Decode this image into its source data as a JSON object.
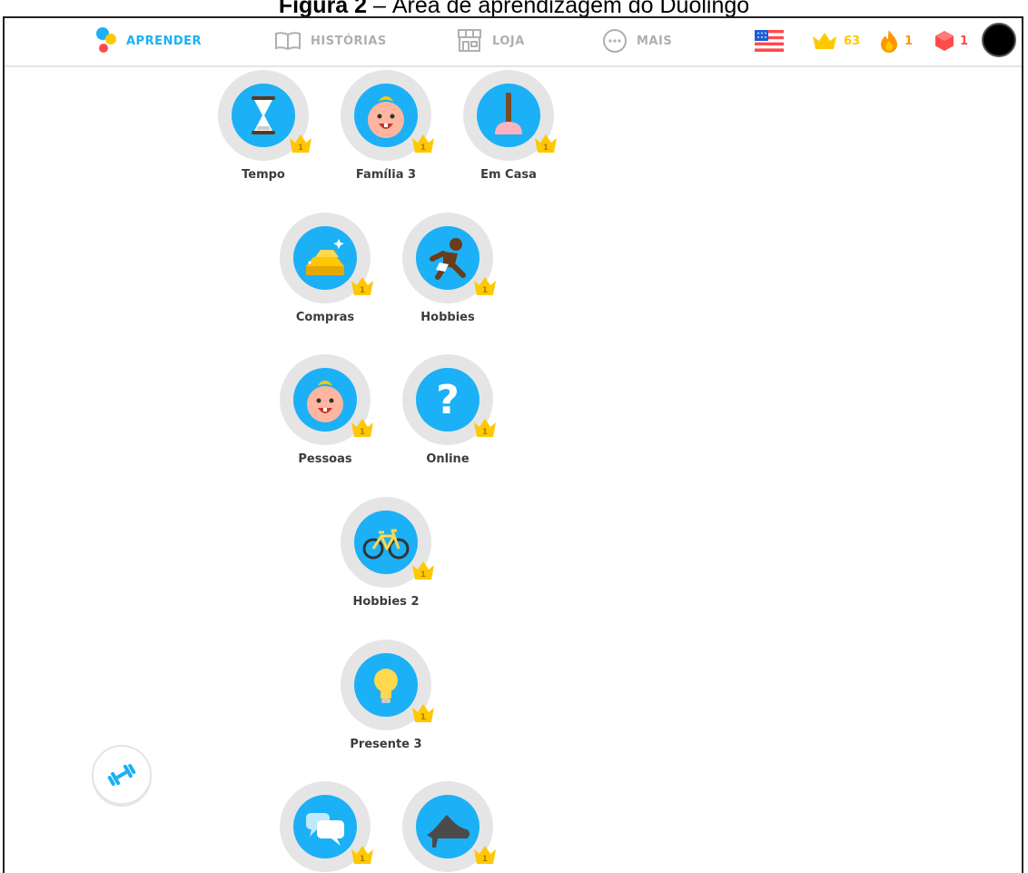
{
  "caption": {
    "prefix": "Figura 2",
    "rest": " – Área de aprendizagem do Duolingo"
  },
  "nav": {
    "learn": "APRENDER",
    "stories": "HISTÓRIAS",
    "shop": "LOJA",
    "more": "MAIS"
  },
  "stats": {
    "crowns": "63",
    "streak": "1",
    "gems": "1"
  },
  "skills": [
    {
      "label": "Tempo",
      "icon": "hourglass-icon",
      "level": "1"
    },
    {
      "label": "Família 3",
      "icon": "baby-face-icon",
      "level": "1"
    },
    {
      "label": "Em Casa",
      "icon": "plunger-icon",
      "level": "1"
    },
    {
      "label": "Compras",
      "icon": "gold-bars-icon",
      "level": "1"
    },
    {
      "label": "Hobbies",
      "icon": "runner-icon",
      "level": "1"
    },
    {
      "label": "Pessoas",
      "icon": "baby-face-icon",
      "level": "1"
    },
    {
      "label": "Online",
      "icon": "question-mark-icon",
      "level": "1"
    },
    {
      "label": "Hobbies 2",
      "icon": "bicycle-icon",
      "level": "1"
    },
    {
      "label": "Presente 3",
      "icon": "light-bulb-icon",
      "level": "1"
    },
    {
      "label": "",
      "icon": "speech-bubbles-icon",
      "level": "1"
    },
    {
      "label": "",
      "icon": "high-heel-icon",
      "level": "1"
    }
  ],
  "colors": {
    "accent": "#1cb0f6",
    "crown": "#ffc800",
    "streak": "#ff9600",
    "gems": "#ff4b4b",
    "ring": "#e5e5e5"
  }
}
